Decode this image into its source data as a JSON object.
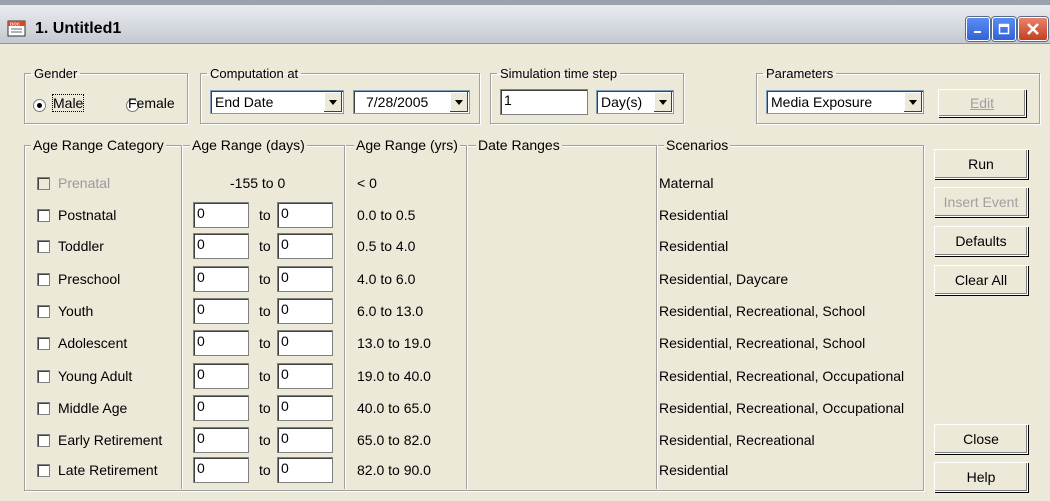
{
  "window": {
    "title": "1. Untitled1",
    "icon": "doc-window-icon"
  },
  "gender": {
    "legend": "Gender",
    "options": [
      {
        "label": "Male",
        "selected": true
      },
      {
        "label": "Female",
        "selected": false
      }
    ]
  },
  "computation": {
    "legend": "Computation at",
    "mode": "End Date",
    "date": "7/28/2005"
  },
  "timestep": {
    "legend": "Simulation time step",
    "value": "1",
    "unit": "Day(s)"
  },
  "parameters": {
    "legend": "Parameters",
    "selected": "Media Exposure",
    "edit_label": "Edit"
  },
  "table": {
    "headers": {
      "category": "Age Range Category",
      "days": "Age Range (days)",
      "yrs": "Age Range (yrs)",
      "dates": "Date Ranges",
      "scenarios": "Scenarios"
    },
    "rows": [
      {
        "category": "Prenatal",
        "days_text": "-155 to 0",
        "yrs": "< 0",
        "scenarios": "Maternal",
        "enabled": false
      },
      {
        "category": "Postnatal",
        "from": "0",
        "to_label": "to",
        "to": "0",
        "yrs": "0.0 to 0.5",
        "scenarios": "Residential",
        "enabled": true
      },
      {
        "category": "Toddler",
        "from": "0",
        "to_label": "to",
        "to": "0",
        "yrs": "0.5 to 4.0",
        "scenarios": "Residential",
        "enabled": true
      },
      {
        "category": "Preschool",
        "from": "0",
        "to_label": "to",
        "to": "0",
        "yrs": "4.0 to 6.0",
        "scenarios": "Residential, Daycare",
        "enabled": true
      },
      {
        "category": "Youth",
        "from": "0",
        "to_label": "to",
        "to": "0",
        "yrs": "6.0 to 13.0",
        "scenarios": "Residential, Recreational, School",
        "enabled": true
      },
      {
        "category": "Adolescent",
        "from": "0",
        "to_label": "to",
        "to": "0",
        "yrs": "13.0 to 19.0",
        "scenarios": "Residential, Recreational, School",
        "enabled": true
      },
      {
        "category": "Young Adult",
        "from": "0",
        "to_label": "to",
        "to": "0",
        "yrs": "19.0 to 40.0",
        "scenarios": "Residential, Recreational, Occupational",
        "enabled": true
      },
      {
        "category": "Middle Age",
        "from": "0",
        "to_label": "to",
        "to": "0",
        "yrs": "40.0 to 65.0",
        "scenarios": "Residential, Recreational, Occupational",
        "enabled": true
      },
      {
        "category": "Early Retirement",
        "from": "0",
        "to_label": "to",
        "to": "0",
        "yrs": "65.0 to 82.0",
        "scenarios": "Residential, Recreational",
        "enabled": true
      },
      {
        "category": "Late Retirement",
        "from": "0",
        "to_label": "to",
        "to": "0",
        "yrs": "82.0 to 90.0",
        "scenarios": "Residential",
        "enabled": true
      }
    ]
  },
  "buttons": {
    "run": "Run",
    "insert_event": "Insert Event",
    "defaults": "Defaults",
    "clear_all": "Clear All",
    "close": "Close",
    "help": "Help"
  }
}
